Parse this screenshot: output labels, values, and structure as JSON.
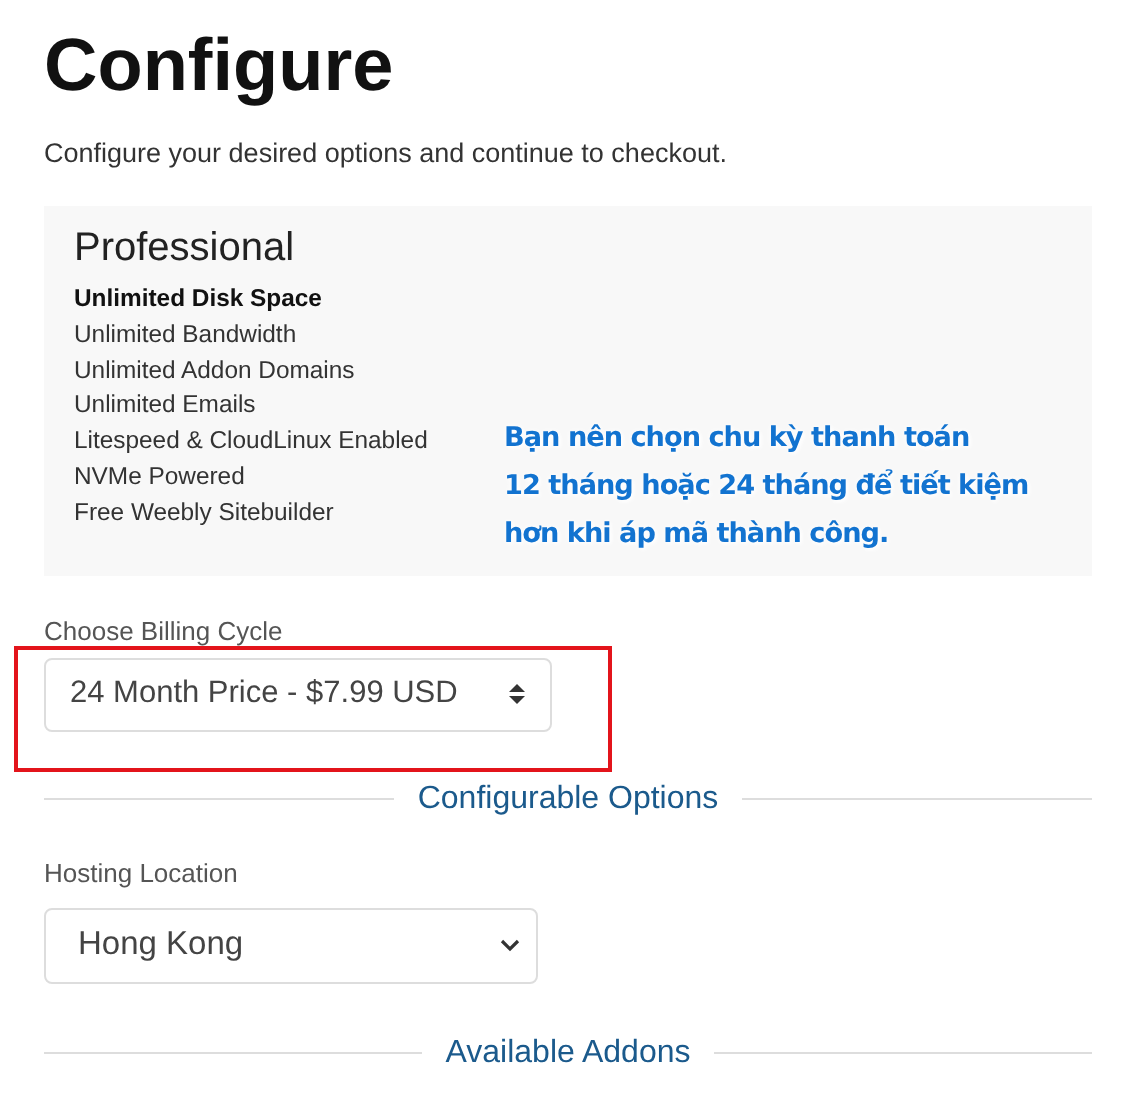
{
  "heading": "Configure",
  "subtitle": "Configure your desired options and continue to checkout.",
  "plan": {
    "name": "Professional",
    "features": [
      {
        "text": "Unlimited Disk Space",
        "emphasized": true
      },
      {
        "text": "Unlimited Bandwidth",
        "emphasized": false
      },
      {
        "text": "Unlimited Addon Domains",
        "emphasized": false
      },
      {
        "text": "Unlimited Emails",
        "emphasized": false
      },
      {
        "text": "Litespeed & CloudLinux Enabled",
        "emphasized": false
      },
      {
        "text": "NVMe Powered",
        "emphasized": false
      },
      {
        "text": "Free Weebly Sitebuilder",
        "emphasized": false
      }
    ]
  },
  "annotation": {
    "lines": [
      "Bạn nên chọn chu kỳ thanh toán",
      "12 tháng hoặc 24 tháng để tiết kiệm",
      "hơn khi áp mã thành công."
    ],
    "highlight_billing": true
  },
  "billing": {
    "label": "Choose Billing Cycle",
    "value": "24 Month Price - $7.99 USD"
  },
  "configurable_options": {
    "heading": "Configurable Options",
    "label": "Hosting Location",
    "value": "Hong Kong"
  },
  "addons": {
    "heading": "Available Addons"
  }
}
